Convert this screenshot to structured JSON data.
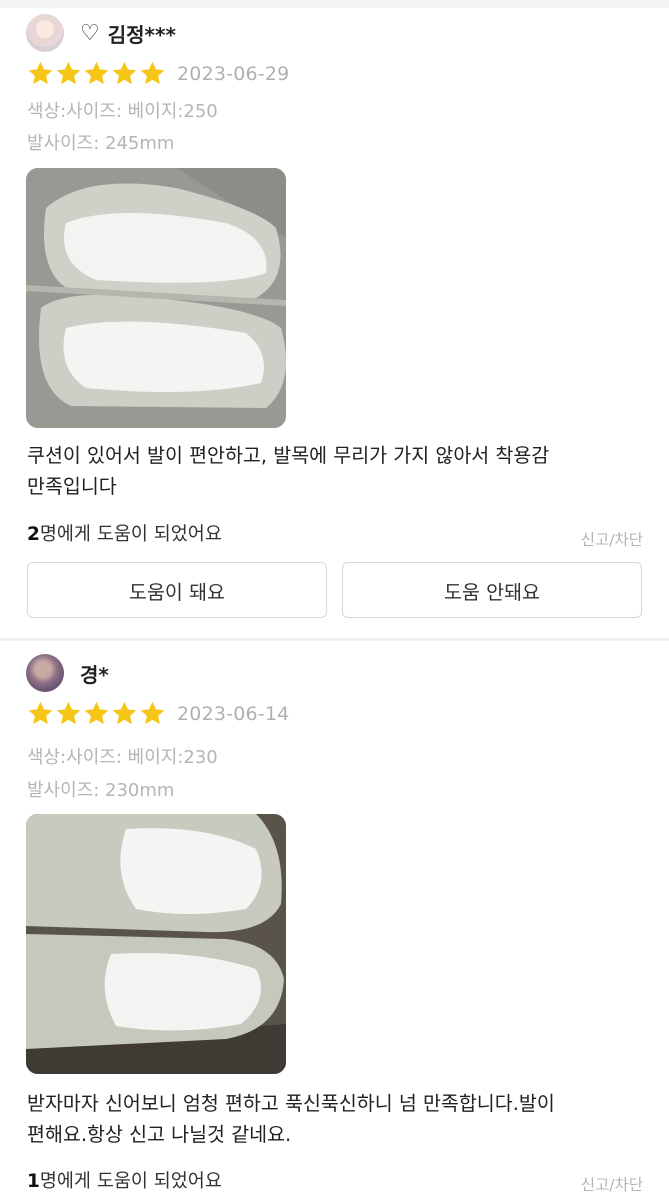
{
  "reviews": [
    {
      "user": {
        "name": "김정***",
        "heart": "♡"
      },
      "rating": 5,
      "date": "2023-06-29",
      "color_size": "색상:사이즈: 베이지:250",
      "foot_size": "발사이즈: 245mm",
      "text_line1": "쿠션이 있어서 발이 편안하고, 발목에 무리가 가지 않아서 착용감",
      "text_line2": "만족입니다",
      "helpful_count": "2",
      "helpful_suffix": "명에게 도움이 되었어요",
      "report": "신고/차단",
      "buttons": {
        "helpful": "도움이 돼요",
        "not_helpful": "도움 안돼요"
      }
    },
    {
      "user": {
        "name": "경*"
      },
      "rating": 5,
      "date": "2023-06-14",
      "color_size": "색상:사이즈: 베이지:230",
      "foot_size": "발사이즈: 230mm",
      "text_line1": "받자마자 신어보니 엄청 편하고 푹신푹신하니 넘 만족합니다.발이",
      "text_line2": "편해요.항상 신고 나닐것 같네요.",
      "helpful_count": "1",
      "helpful_suffix": "명에게 도움이 되었어요",
      "report": "신고/차단"
    }
  ],
  "colors": {
    "star": "#f5c518",
    "muted": "#b0b0b0",
    "border": "#d8d8d8"
  },
  "icons": {
    "star": "star-icon",
    "heart": "heart-outline-icon"
  }
}
